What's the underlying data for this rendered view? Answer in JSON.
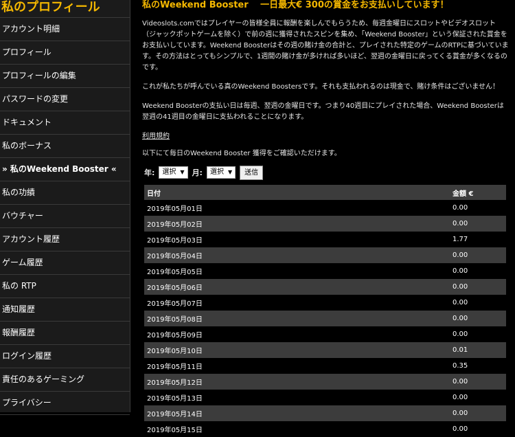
{
  "sidebar": {
    "title": "私のプロフィール",
    "items": [
      {
        "label": "アカウント明細",
        "active": false
      },
      {
        "label": "プロフィール",
        "active": false
      },
      {
        "label": "プロフィールの編集",
        "active": false
      },
      {
        "label": "パスワードの変更",
        "active": false
      },
      {
        "label": "ドキュメント",
        "active": false
      },
      {
        "label": "私のボーナス",
        "active": false
      },
      {
        "label": "» 私のWeekend Booster «",
        "active": true
      },
      {
        "label": "私の功績",
        "active": false
      },
      {
        "label": "バウチャー",
        "active": false
      },
      {
        "label": "アカウント履歴",
        "active": false
      },
      {
        "label": "ゲーム履歴",
        "active": false
      },
      {
        "label": "私の RTP",
        "active": false
      },
      {
        "label": "通知履歴",
        "active": false
      },
      {
        "label": "報酬履歴",
        "active": false
      },
      {
        "label": "ログイン履歴",
        "active": false
      },
      {
        "label": "責任のあるゲーミング",
        "active": false
      },
      {
        "label": "プライバシー",
        "active": false
      }
    ]
  },
  "main": {
    "headline": "私のWeekend Booster　 一日最大€ 300の賞金をお支払いしています！",
    "paragraphs": [
      "Videoslots.comではプレイヤーの皆様全員に報酬を楽しんでもらうため、毎週金曜日にスロットやビデオスロット（ジャックポットゲームを除く）で前の週に獲得されたスピンを集め、「Weekend Booster」という保証された賞金をお支払いしています。Weekend Boosterはその週の賭け金の合計と、プレイされた特定のゲームのRTPに基づいています。その方法はとってもシンプルで、1週間の賭け金が多ければ多いほど、翌週の金曜日に戻ってくる賞金が多くなるのです。",
      "これが私たちが呼んでいる真のWeekend Boostersです。それも支払われるのは現金で、賭け条件はございません！",
      "Weekend Boosterの支払い日は毎週、翌週の金曜日です。つまり40週目にプレイされた場合、Weekend Boosterは翌週の41週目の金曜日に支払われることになります。"
    ],
    "terms_link": "利用規約",
    "prompt": "以下にて毎日のWeekend Booster 獲得をご確認いただけます。",
    "filters": {
      "year_label": "年:",
      "year_value": "選択",
      "month_label": "月:",
      "month_value": "選択",
      "submit_label": "送信"
    },
    "table": {
      "headers": [
        "日付",
        "金額 €"
      ],
      "rows": [
        [
          "2019年05月01日",
          "0.00"
        ],
        [
          "2019年05月02日",
          "0.00"
        ],
        [
          "2019年05月03日",
          "1.77"
        ],
        [
          "2019年05月04日",
          "0.00"
        ],
        [
          "2019年05月05日",
          "0.00"
        ],
        [
          "2019年05月06日",
          "0.00"
        ],
        [
          "2019年05月07日",
          "0.00"
        ],
        [
          "2019年05月08日",
          "0.00"
        ],
        [
          "2019年05月09日",
          "0.00"
        ],
        [
          "2019年05月10日",
          "0.01"
        ],
        [
          "2019年05月11日",
          "0.35"
        ],
        [
          "2019年05月12日",
          "0.00"
        ],
        [
          "2019年05月13日",
          "0.00"
        ],
        [
          "2019年05月14日",
          "0.00"
        ],
        [
          "2019年05月15日",
          "0.00"
        ]
      ]
    }
  }
}
